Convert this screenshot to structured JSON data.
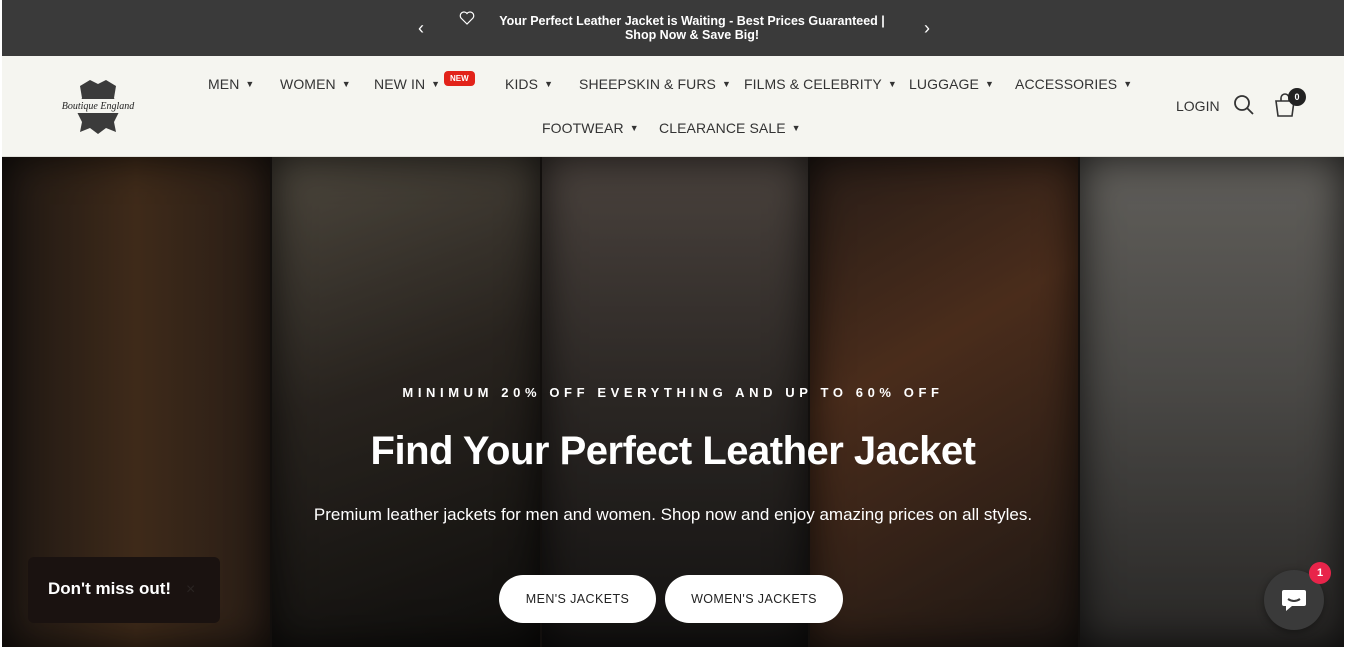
{
  "announcement": {
    "message": "Your Perfect Leather Jacket is Waiting - Best Prices Guaranteed | Shop Now & Save Big!",
    "prev_arrow": "‹",
    "next_arrow": "›",
    "icon": "heart-icon"
  },
  "header": {
    "logo": {
      "text": "Boutique England",
      "icon": "leather-hide-logo"
    },
    "nav": [
      {
        "label": "MEN"
      },
      {
        "label": "WOMEN"
      },
      {
        "label": "NEW IN",
        "badge": "NEW"
      },
      {
        "label": "KIDS"
      },
      {
        "label": "SHEEPSKIN & FURS"
      },
      {
        "label": "FILMS & CELEBRITY"
      },
      {
        "label": "LUGGAGE"
      },
      {
        "label": "ACCESSORIES"
      },
      {
        "label": "FOOTWEAR"
      },
      {
        "label": "CLEARANCE SALE"
      }
    ],
    "login_label": "LOGIN",
    "cart_count": "0",
    "icons": {
      "search": "search-icon",
      "cart": "shopping-bag-icon",
      "dropdown": "chevron-down-icon"
    }
  },
  "hero": {
    "eyebrow": "MINIMUM 20% OFF EVERYTHING AND UP TO 60% OFF",
    "headline": "Find Your Perfect Leather Jacket",
    "subhead": "Premium leather jackets for men and women. Shop now and enjoy amazing prices on all styles.",
    "buttons": {
      "men": "MEN'S JACKETS",
      "women": "WOMEN'S JACKETS"
    }
  },
  "popup": {
    "text": "Don't miss out!",
    "close": "×"
  },
  "chat": {
    "badge": "1",
    "icon": "chat-bubble-icon"
  },
  "colors": {
    "announcement_bg": "#3a3a3a",
    "header_bg": "#f5f5f0",
    "badge_red": "#e2231a",
    "chat_badge": "#e8244a"
  }
}
